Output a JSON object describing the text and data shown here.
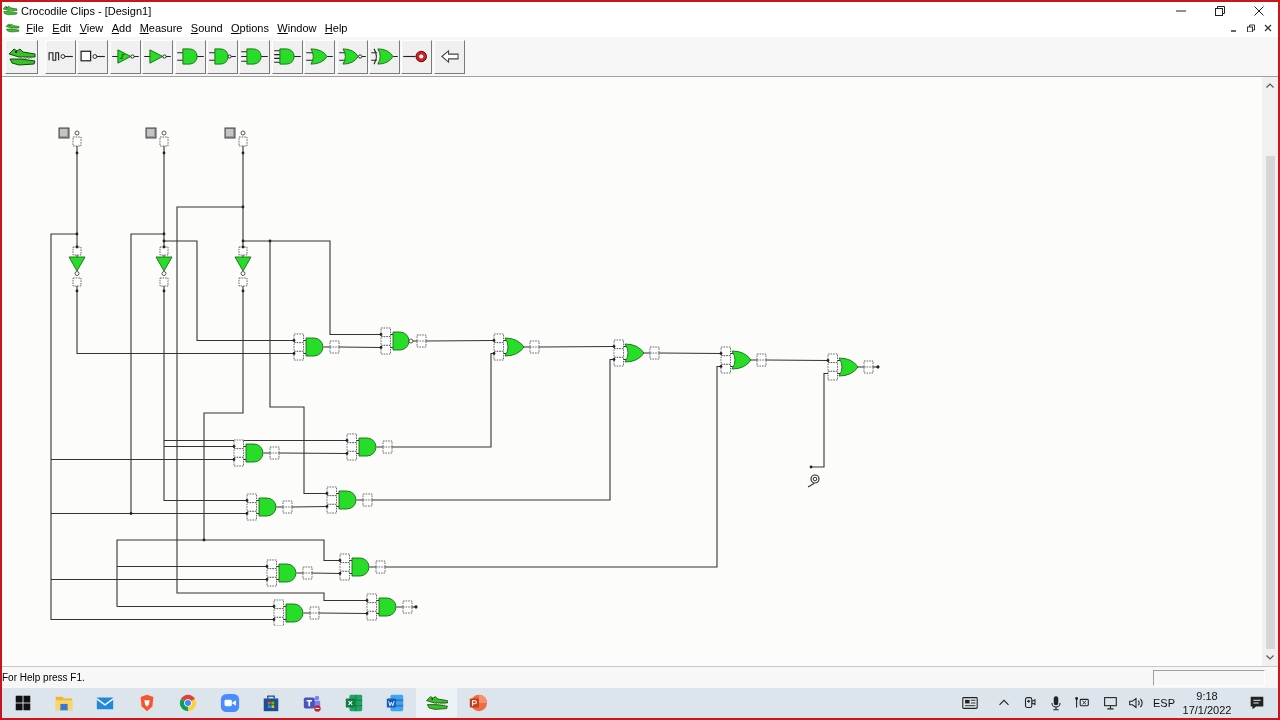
{
  "window": {
    "title": "Crocodile Clips - [Design1]"
  },
  "menu": [
    "File",
    "Edit",
    "View",
    "Add",
    "Measure",
    "Sound",
    "Options",
    "Window",
    "Help"
  ],
  "toolbar": [
    {
      "kind": "crocodile"
    },
    {
      "kind": "pulse"
    },
    {
      "kind": "switch"
    },
    {
      "kind": "schmitt"
    },
    {
      "kind": "not"
    },
    {
      "kind": "and"
    },
    {
      "kind": "nand"
    },
    {
      "kind": "and3"
    },
    {
      "kind": "and4"
    },
    {
      "kind": "or"
    },
    {
      "kind": "nor"
    },
    {
      "kind": "xor"
    },
    {
      "kind": "probe"
    },
    {
      "kind": "back"
    }
  ],
  "status_bar": {
    "text": "For Help press F1."
  },
  "taskbar": {
    "apps": [
      {
        "kind": "start",
        "active": false
      },
      {
        "kind": "folder",
        "active": false
      },
      {
        "kind": "mail",
        "active": false
      },
      {
        "kind": "shield",
        "active": false
      },
      {
        "kind": "browser",
        "active": false
      },
      {
        "kind": "camera",
        "active": false
      },
      {
        "kind": "store",
        "active": false
      },
      {
        "kind": "chat",
        "active": false
      },
      {
        "kind": "sheet",
        "active": false
      },
      {
        "kind": "doc",
        "active": false
      },
      {
        "kind": "crocodile",
        "active": true
      },
      {
        "kind": "slides",
        "active": false
      }
    ],
    "language": "ESP",
    "time": "9:18",
    "date": "17/1/2022"
  }
}
